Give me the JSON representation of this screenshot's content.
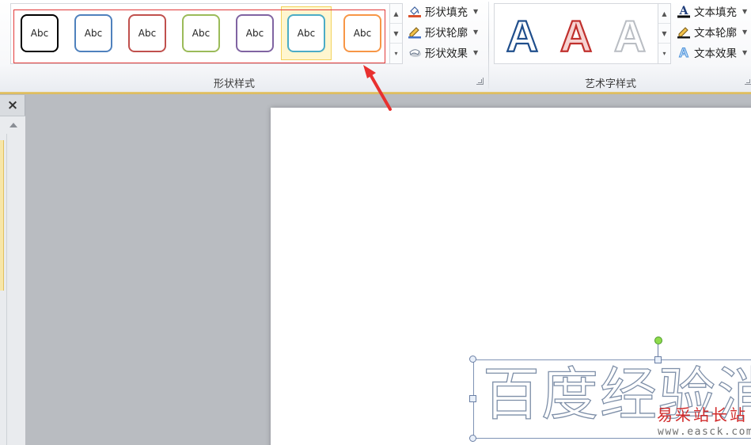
{
  "ribbon": {
    "shape_styles": {
      "group_label": "形状样式",
      "gallery_items": [
        {
          "label": "Abc",
          "outline": "#000000",
          "selected": false
        },
        {
          "label": "Abc",
          "outline": "#4f81bd",
          "selected": false
        },
        {
          "label": "Abc",
          "outline": "#c0504d",
          "selected": false
        },
        {
          "label": "Abc",
          "outline": "#9bbb59",
          "selected": false
        },
        {
          "label": "Abc",
          "outline": "#8064a2",
          "selected": false
        },
        {
          "label": "Abc",
          "outline": "#4bacc6",
          "selected": true
        },
        {
          "label": "Abc",
          "outline": "#f79646",
          "selected": false
        }
      ],
      "commands": {
        "fill": "形状填充",
        "outline": "形状轮廓",
        "effects": "形状效果"
      }
    },
    "wordart_styles": {
      "group_label": "艺术字样式",
      "letters": [
        {
          "char": "A",
          "style": "blue-outline"
        },
        {
          "char": "A",
          "style": "red-outline"
        },
        {
          "char": "A",
          "style": "gray-outline"
        }
      ],
      "commands": {
        "fill": "文本填充",
        "outline": "文本轮廓",
        "effects": "文本效果"
      }
    },
    "highlight_color": "#e23a3a"
  },
  "slide": {
    "wordart_text": "百度经验消",
    "watermark": "易采站长站",
    "watermark_url": "www.easck.com"
  },
  "icons": {
    "close": "×"
  }
}
